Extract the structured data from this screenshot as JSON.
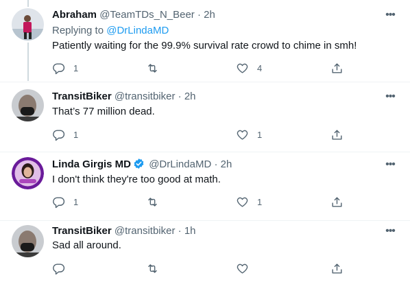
{
  "tweets": [
    {
      "name": "Abraham",
      "handle": "@TeamTDs_N_Beer",
      "time": "2h",
      "replying_prefix": "Replying to ",
      "replying_to": "@DrLindaMD",
      "text": "Patiently waiting for the 99.9% survival rate crowd to chime in smh!",
      "reply_count": "1",
      "retweet_count": "",
      "like_count": "4",
      "show_retweet": true
    },
    {
      "name": "TransitBiker",
      "handle": "@transitbiker",
      "time": "2h",
      "text": "That’s 77 million dead.",
      "reply_count": "1",
      "retweet_count": "",
      "like_count": "1",
      "show_retweet": false
    },
    {
      "name": "Linda Girgis MD",
      "handle": "@DrLindaMD",
      "time": "2h",
      "text": "I don't think they're too good at math.",
      "reply_count": "1",
      "retweet_count": "",
      "like_count": "1",
      "show_retweet": true
    },
    {
      "name": "TransitBiker",
      "handle": "@transitbiker",
      "time": "1h",
      "text": "Sad all around.",
      "reply_count": "",
      "retweet_count": "",
      "like_count": "",
      "show_retweet": true
    }
  ],
  "separator": "·",
  "more_glyph": "•••",
  "colors": {
    "link": "#1d9bf0",
    "secondary": "#536471",
    "thread_line": "#cfd9de",
    "verified": "#1d9bf0"
  },
  "icons": {
    "reply": "reply-icon",
    "retweet": "retweet-icon",
    "like": "heart-icon",
    "share": "share-icon",
    "more": "more-icon",
    "verified": "verified-badge-icon"
  }
}
